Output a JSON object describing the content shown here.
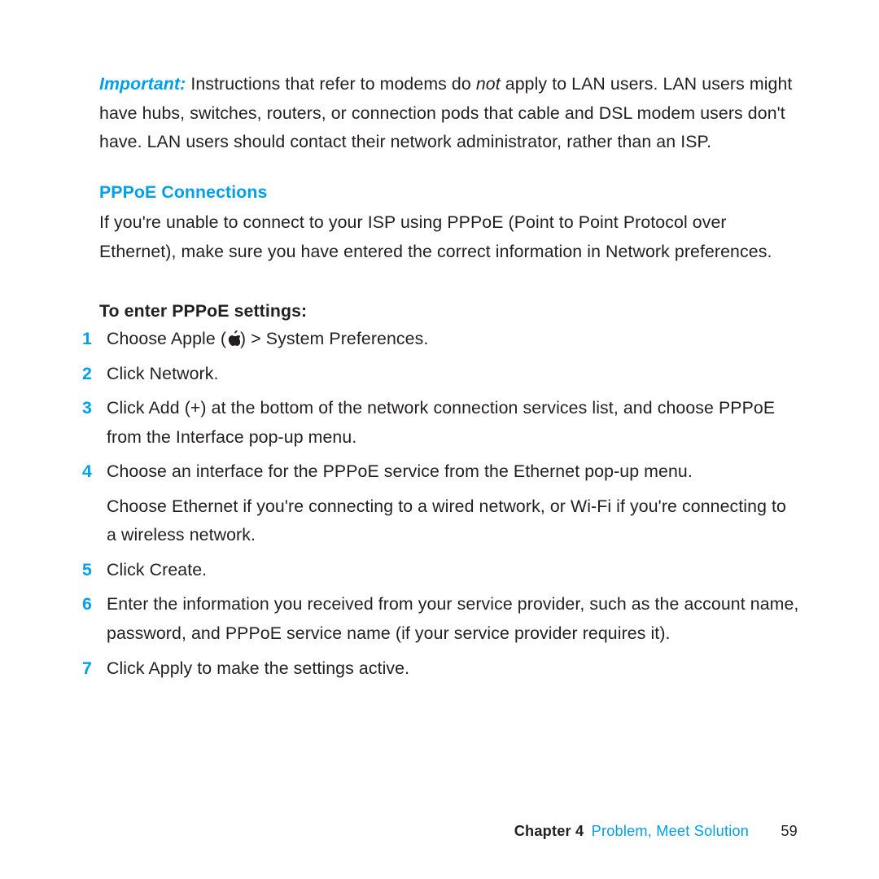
{
  "important": {
    "label": "Important:",
    "body_before_not": "  Instructions that refer to modems do ",
    "not": "not",
    "body_after_not": " apply to LAN users. LAN users might have hubs, switches, routers, or connection pods that cable and DSL modem users don't have. LAN users should contact their network administrator, rather than an ISP."
  },
  "section_heading": "PPPoE Connections",
  "pppoe_intro": "If you're unable to connect to your ISP using PPPoE (Point to Point Protocol over Ethernet), make sure you have entered the correct information in Network preferences.",
  "instruction_heading": "To enter PPPoE settings:",
  "steps": [
    {
      "n": "1",
      "paras": [
        "Choose Apple ( ) > System Preferences."
      ]
    },
    {
      "n": "2",
      "paras": [
        "Click Network."
      ]
    },
    {
      "n": "3",
      "paras": [
        "Click Add (+) at the bottom of the network connection services list, and choose PPPoE from the Interface pop-up menu."
      ]
    },
    {
      "n": "4",
      "paras": [
        "Choose an interface for the PPPoE service from the Ethernet pop-up menu.",
        "Choose Ethernet if you're connecting to a wired network, or Wi-Fi if you're connecting to a wireless network."
      ]
    },
    {
      "n": "5",
      "paras": [
        "Click Create."
      ]
    },
    {
      "n": "6",
      "paras": [
        "Enter the information you received from your service provider, such as the account name, password, and PPPoE service name (if your service provider requires it)."
      ]
    },
    {
      "n": "7",
      "paras": [
        "Click Apply to make the settings active."
      ]
    }
  ],
  "footer": {
    "chapter": "Chapter 4",
    "title": "Problem, Meet Solution",
    "page": "59"
  },
  "icon_names": {
    "apple": "apple-logo-icon"
  }
}
